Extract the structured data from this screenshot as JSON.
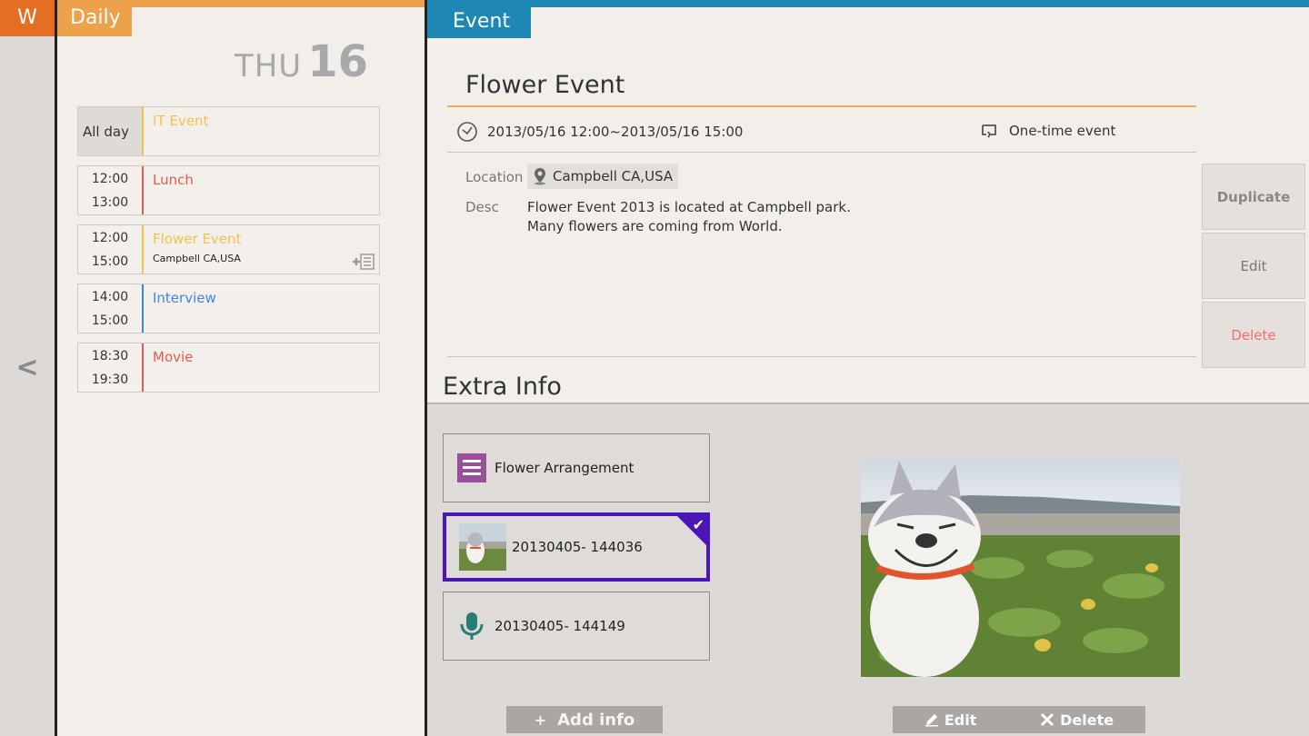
{
  "week_strip": {
    "tab_label": "W",
    "back_label": "<"
  },
  "daily": {
    "tab_label": "Daily",
    "day_of_week": "THU",
    "day_number": "16",
    "events": [
      {
        "start": "All day",
        "end": "",
        "title": "IT Event",
        "subtitle": "",
        "color": "#f2c14e",
        "all_day": true
      },
      {
        "start": "12:00",
        "end": "13:00",
        "title": "Lunch",
        "subtitle": "",
        "color": "#e8594d"
      },
      {
        "start": "12:00",
        "end": "15:00",
        "title": "Flower Event",
        "subtitle": "Campbell CA,USA",
        "color": "#f2c14e",
        "has_note_icon": true
      },
      {
        "start": "14:00",
        "end": "15:00",
        "title": "Interview",
        "subtitle": "",
        "color": "#3f86d8"
      },
      {
        "start": "18:30",
        "end": "19:30",
        "title": "Movie",
        "subtitle": "",
        "color": "#e8594d"
      }
    ]
  },
  "event": {
    "tab_label": "Event",
    "title": "Flower Event",
    "datetime": "2013/05/16 12:00~2013/05/16 15:00",
    "recurrence": "One-time event",
    "location_label": "Location",
    "location_value": "Campbell CA,USA",
    "desc_label": "Desc",
    "desc_line1": "Flower Event 2013 is located at Campbell park.",
    "desc_line2": "Many flowers are coming from World.",
    "actions": {
      "duplicate": "Duplicate",
      "edit": "Edit",
      "delete": "Delete"
    }
  },
  "extra": {
    "title": "Extra Info",
    "items": [
      {
        "label": "Flower Arrangement",
        "kind": "note",
        "icon": "note-icon"
      },
      {
        "label": "20130405- 144036",
        "kind": "photo",
        "icon": "photo-thumbnail",
        "selected": true
      },
      {
        "label": "20130405- 144149",
        "kind": "audio",
        "icon": "microphone-icon"
      }
    ],
    "add_info_label": "Add info",
    "photo_edit_label": "Edit",
    "photo_delete_label": "Delete"
  },
  "colors": {
    "week_accent": "#e46f24",
    "daily_accent": "#eea14b",
    "event_accent": "#1e87b3",
    "selection": "#4b16b8",
    "delete_text": "#ef6e6a",
    "note_purple": "#9a4f9e",
    "mic_teal": "#2a7c79"
  }
}
